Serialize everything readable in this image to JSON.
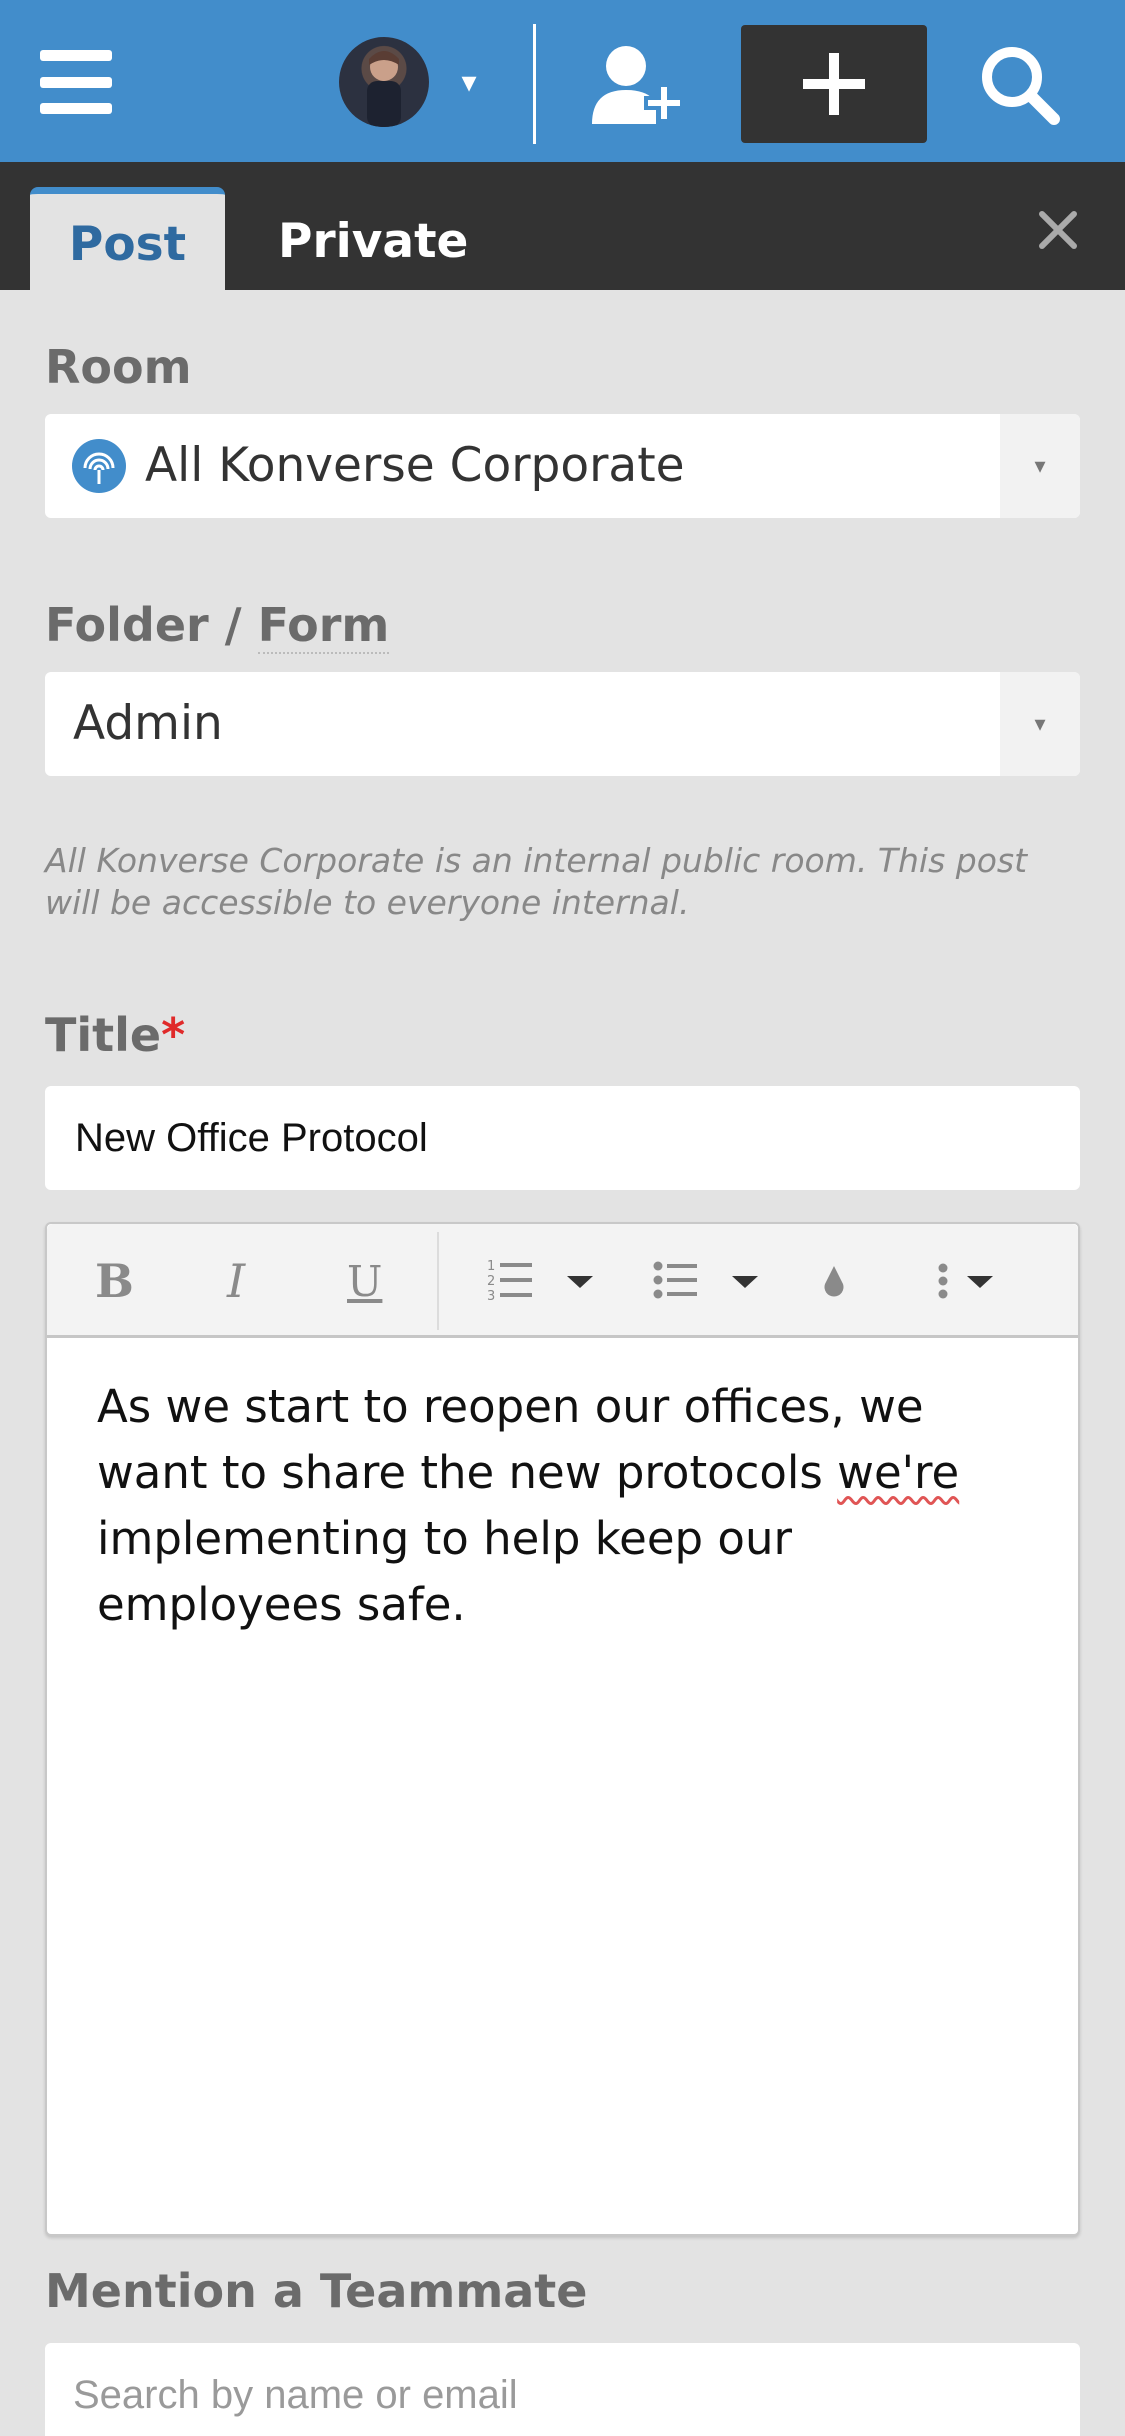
{
  "header": {
    "menu_icon": "hamburger-menu-icon",
    "avatar_caret": "▾",
    "add_user_icon": "add-user-icon",
    "new_post_icon": "plus-icon",
    "search_icon": "search-icon",
    "color": "#428dcb"
  },
  "tabs": {
    "post": "Post",
    "private": "Private",
    "close_icon": "close-icon"
  },
  "room": {
    "label": "Room",
    "value": "All Konverse Corporate",
    "icon": "broadcast-icon",
    "arrow": "▾"
  },
  "folder": {
    "label_a": "Folder / ",
    "label_b": "Form",
    "value": "Admin",
    "arrow": "▾"
  },
  "hint": "All Konverse Corporate is an internal public room. This post will be accessible to everyone internal.",
  "title": {
    "label": "Title",
    "required_mark": "*",
    "value": "New Office Protocol"
  },
  "editor": {
    "toolbar": {
      "bold": "B",
      "italic": "I",
      "underline": "U",
      "numbered_list_icon": "numbered-list-icon",
      "bullet_list_icon": "bullet-list-icon",
      "color_icon": "ink-drop-icon",
      "more_icon": "more-vertical-icon"
    },
    "body_before": "As we start to reopen our offices, we want to share the new protocols ",
    "body_misspelled": "we're",
    "body_after": " implementing to help keep our employees safe."
  },
  "mention": {
    "label": "Mention a Teammate",
    "placeholder": "Search by name or email"
  }
}
